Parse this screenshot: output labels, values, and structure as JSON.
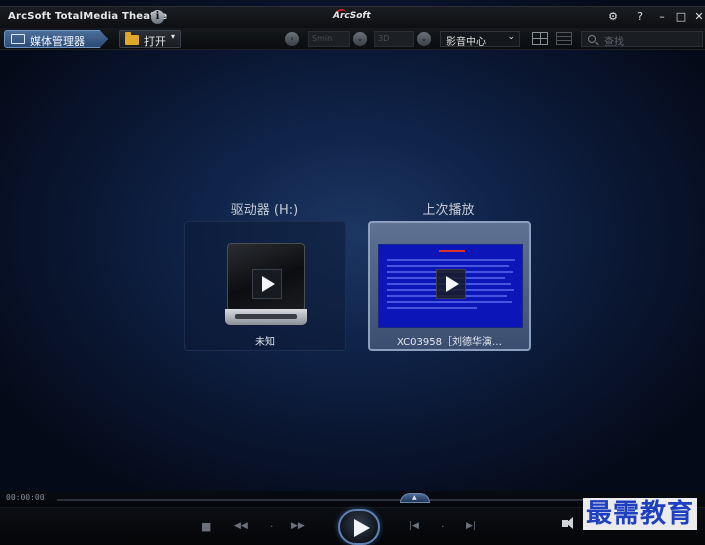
{
  "window": {
    "title": "ArcSoft TotalMedia Theatre",
    "brand": "ArcSoft",
    "controls": [
      "⚙",
      "?",
      "–",
      "□",
      "✕"
    ]
  },
  "toolbar": {
    "media_manager_label": "媒体管理器",
    "open_label": "打开",
    "open_caret": "▾",
    "mode_select": {
      "selected": "影音中心",
      "caret": "⌄"
    },
    "search": {
      "placeholder": "查找"
    },
    "dim_button_1": "Smin",
    "dim_button_2": "3D"
  },
  "tiles": {
    "drive": {
      "heading": "驱动器 (H:)",
      "caption": "未知",
      "icon": "disc-drive-icon"
    },
    "recent": {
      "heading": "上次播放",
      "caption": "XC03958［刘德华演…",
      "icon": "video-thumbnail"
    }
  },
  "player": {
    "time": "00:00:00",
    "icons": {
      "stop": "■",
      "rewind": "◀◀",
      "dot1": "·",
      "forward": "▶▶",
      "prev": "|◀",
      "dot2": "·",
      "next": "▶|"
    }
  },
  "watermark": "最需教育",
  "colors": {
    "accent": "#5f82b3",
    "background": "#10244a",
    "watermark": "#1e3fbf"
  }
}
